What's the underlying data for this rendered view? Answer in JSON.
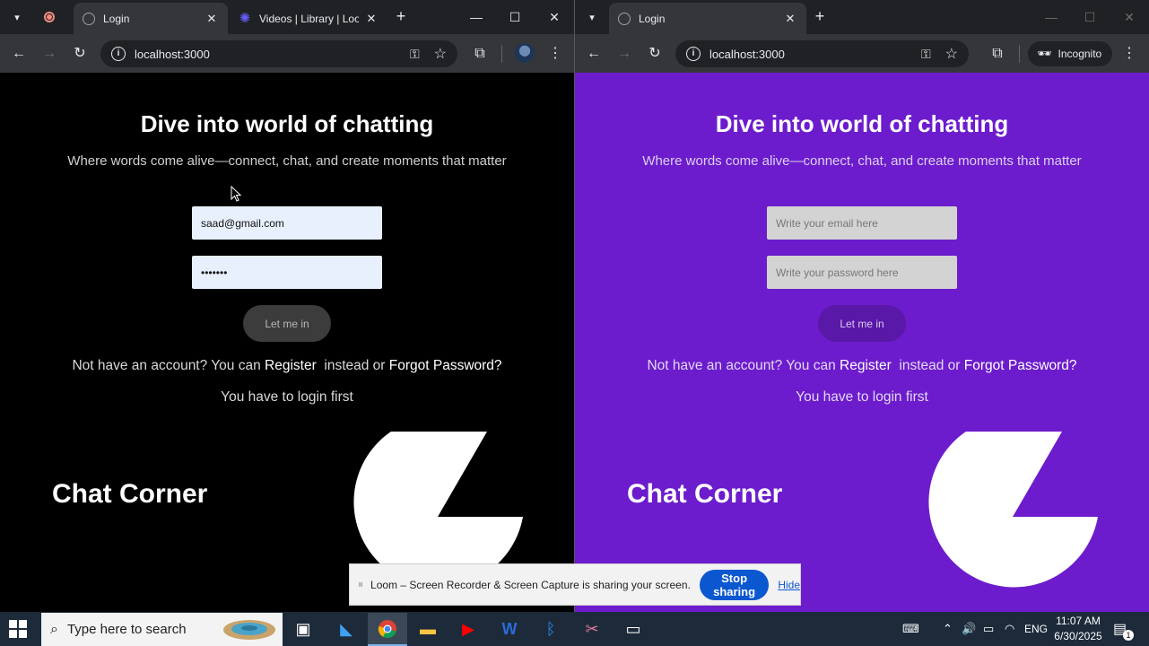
{
  "left_browser": {
    "tabs": [
      {
        "title": "Login",
        "icon": "globe-icon"
      },
      {
        "title": "Videos | Library | Loom",
        "icon": "loom-icon"
      }
    ],
    "url": "localhost:3000",
    "page": {
      "heading": "Dive into world of chatting",
      "subtitle": "Where words come alive—connect, chat, and create moments that matter",
      "email_value": "saad@gmail.com",
      "email_placeholder": "Write your email here",
      "password_value": "•••••••",
      "password_placeholder": "Write your password here",
      "login_button": "Let me in",
      "account_prefix": "Not have an account? You can",
      "register_link": "Register",
      "account_middle": "instead or",
      "forgot_link": "Forgot Password?",
      "notice": "You have to login first",
      "brand": "Chat Corner"
    },
    "colors": {
      "page_bg": "#000000"
    }
  },
  "right_browser": {
    "tabs": [
      {
        "title": "Login",
        "icon": "globe-icon"
      }
    ],
    "url": "localhost:3000",
    "incognito_label": "Incognito",
    "page": {
      "heading": "Dive into world of chatting",
      "subtitle": "Where words come alive—connect, chat, and create moments that matter",
      "email_value": "",
      "email_placeholder": "Write your email here",
      "password_value": "",
      "password_placeholder": "Write your password here",
      "login_button": "Let me in",
      "account_prefix": "Not have an account? You can",
      "register_link": "Register",
      "account_middle": "instead or",
      "forgot_link": "Forgot Password?",
      "notice": "You have to login first",
      "brand": "Chat Corner"
    },
    "colors": {
      "page_bg": "#6c1ccc"
    }
  },
  "loom_bar": {
    "message": "Loom – Screen Recorder & Screen Capture is sharing your screen.",
    "stop_button": "Stop sharing",
    "hide_link": "Hide"
  },
  "taskbar": {
    "search_placeholder": "Type here to search",
    "apps": [
      "task-view",
      "vs-code",
      "chrome",
      "file-explorer",
      "youtube",
      "word",
      "bluetooth",
      "snipping-tool",
      "terminal"
    ],
    "language": "ENG",
    "time": "11:07 AM",
    "date": "6/30/2025",
    "notification_count": "1"
  }
}
